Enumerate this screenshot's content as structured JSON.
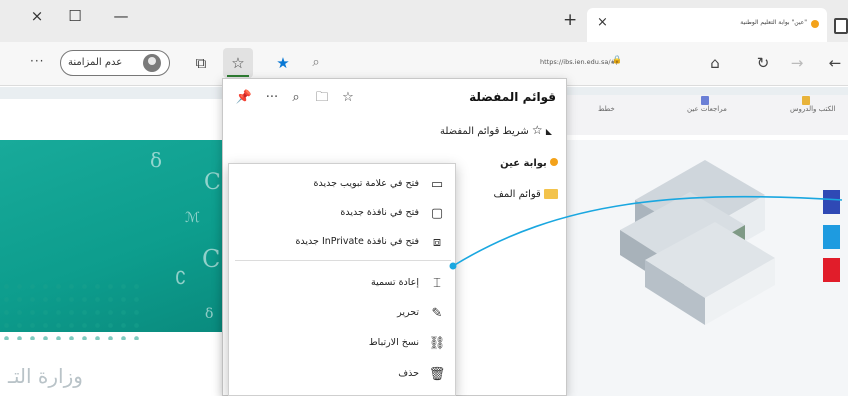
{
  "titlebar": {
    "window_close": "×",
    "window_restore": "☐",
    "window_minimize": "—",
    "new_tab": "+",
    "tab": {
      "title": "\"عين\" بوابة التعليم الوطنية",
      "close": "×"
    }
  },
  "toolbar": {
    "more": "···",
    "profile_label": "عدم المزامنة",
    "url": "https://ibs.ien.edu.sa/#/",
    "icons": {
      "collections": "⧉",
      "favorites": "☆",
      "add_favorite": "★",
      "zoom": "⌕",
      "home": "⌂",
      "refresh": "↻",
      "back": "←",
      "forward": "→",
      "lock": "🔒"
    }
  },
  "page": {
    "nav": [
      "الكتب والدروس",
      "مراجعات عين",
      "خطط"
    ],
    "ministry": "وزارة التـ"
  },
  "favorites_panel": {
    "title": "قوائم المفضلة",
    "icons": [
      "📌",
      "···",
      "⌕",
      "🗀",
      "☆"
    ],
    "bar_label": "شريط قوائم المفضلة",
    "site_label": "بوابة عين",
    "folder_label": "قوائم المف"
  },
  "context_menu": {
    "items": [
      {
        "label": "فتح في علامة تبويب جديدة",
        "icon": "▭"
      },
      {
        "label": "فتح في نافذة جديدة",
        "icon": "▢"
      },
      {
        "label": "فتح في نافذة InPrivate جديدة",
        "icon": "⧈"
      },
      {
        "label": "إعادة تسمية",
        "icon": "⌶"
      },
      {
        "label": "تحرير",
        "icon": "✎"
      },
      {
        "label": "نسخ الارتباط",
        "icon": "⛓"
      },
      {
        "label": "حذف",
        "icon": "🗑"
      }
    ]
  },
  "colors": {
    "accent": "#0a78d4",
    "teal": "#12a594",
    "callout": "#1aa7e0"
  }
}
